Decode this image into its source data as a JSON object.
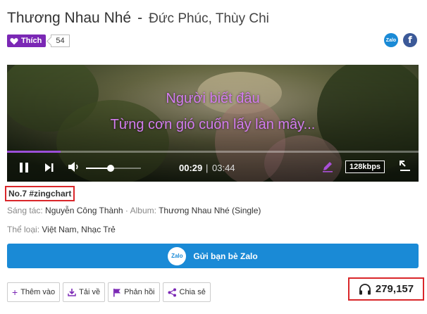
{
  "song": {
    "title": "Thương Nhau Nhé",
    "separator": "-",
    "artists": "Đức Phúc, Thùy Chi"
  },
  "like": {
    "label": "Thích",
    "count": "54"
  },
  "share_icons": [
    {
      "icon": "zalo-icon",
      "label": "Zalo"
    },
    {
      "icon": "facebook-icon",
      "label": "f"
    }
  ],
  "player": {
    "lyrics": [
      "Người biết đâu",
      "Từng cơn gió cuốn lấy làn mây..."
    ],
    "current_time": "00:29",
    "time_separator": "|",
    "total_time": "03:44",
    "bitrate": "128kbps",
    "progress_fraction": 0.13,
    "volume_fraction": 0.45,
    "lyric_color": "#d37cf0",
    "accent_color": "#9b4fd8"
  },
  "chart_rank": "No.7 #zingchart",
  "info": {
    "composer_label": "Sáng tác:",
    "composer": "Nguyễn Công Thành",
    "album_label": "Album:",
    "album": "Thương Nhau Nhé (Single)",
    "genre_label": "Thể loại:",
    "genre": "Việt Nam, Nhạc Trẻ"
  },
  "zalo_share": {
    "logo": "Zalo",
    "label": "Gửi bạn bè Zalo",
    "color": "#1a8ad6"
  },
  "actions": [
    {
      "icon": "plus-icon",
      "label": "Thêm vào"
    },
    {
      "icon": "download-icon",
      "label": "Tải về"
    },
    {
      "icon": "flag-icon",
      "label": "Phản hồi"
    },
    {
      "icon": "share-icon",
      "label": "Chia sẻ"
    }
  ],
  "listen_count": "279,157",
  "brand_color": "#7b28b5",
  "highlight_color": "#d9262a"
}
